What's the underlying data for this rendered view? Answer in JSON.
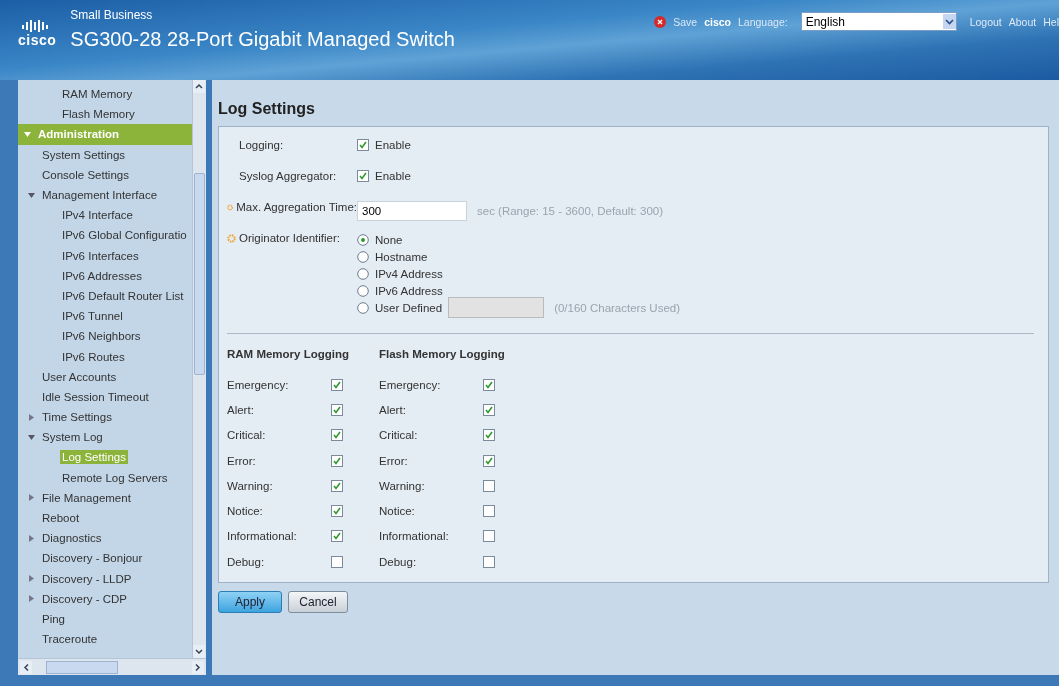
{
  "header": {
    "logo_text": "cisco",
    "brand_line": "Small Business",
    "title": "SG300-28 28-Port Gigabit Managed Switch",
    "save": "Save",
    "user": "cisco",
    "language_label": "Language:",
    "language_value": "English",
    "links": [
      "Logout",
      "About",
      "Hel"
    ]
  },
  "sidebar": {
    "partial_group": {
      "children": [
        {
          "label": "RAM Memory",
          "selected": false
        },
        {
          "label": "Flash Memory",
          "selected": false
        }
      ]
    },
    "items": [
      {
        "label": "Administration",
        "kind": "section",
        "expanded": true,
        "children": [
          {
            "label": "System Settings",
            "selected": false
          },
          {
            "label": "Console Settings",
            "selected": false
          },
          {
            "label": "Management Interface",
            "selected": false,
            "expanded": true,
            "children": [
              {
                "label": "IPv4 Interface",
                "selected": false
              },
              {
                "label": "IPv6 Global Configuratio",
                "selected": false
              },
              {
                "label": "IPv6 Interfaces",
                "selected": false
              },
              {
                "label": "IPv6 Addresses",
                "selected": false
              },
              {
                "label": "IPv6 Default Router List",
                "selected": false
              },
              {
                "label": "IPv6 Tunnel",
                "selected": false
              },
              {
                "label": "IPv6 Neighbors",
                "selected": false
              },
              {
                "label": "IPv6 Routes",
                "selected": false
              }
            ]
          },
          {
            "label": "User Accounts",
            "selected": false
          },
          {
            "label": "Idle Session Timeout",
            "selected": false
          },
          {
            "label": "Time Settings",
            "selected": false,
            "expanded": false
          },
          {
            "label": "System Log",
            "selected": false,
            "expanded": true,
            "children": [
              {
                "label": "Log Settings",
                "selected": true
              },
              {
                "label": "Remote Log Servers",
                "selected": false
              }
            ]
          },
          {
            "label": "File Management",
            "selected": false,
            "expanded": false
          },
          {
            "label": "Reboot",
            "selected": false
          },
          {
            "label": "Diagnostics",
            "selected": false,
            "expanded": false
          },
          {
            "label": "Discovery - Bonjour",
            "selected": false
          },
          {
            "label": "Discovery - LLDP",
            "selected": false,
            "expanded": false
          },
          {
            "label": "Discovery - CDP",
            "selected": false,
            "expanded": false
          },
          {
            "label": "Ping",
            "selected": false
          },
          {
            "label": "Traceroute",
            "selected": false
          }
        ]
      }
    ]
  },
  "page_title": "Log Settings",
  "settings": [
    {
      "kind": "checkbox",
      "label": "Logging:",
      "required": false,
      "option": "Enable",
      "checked": true
    },
    {
      "kind": "checkbox",
      "label": "Syslog Aggregator:",
      "required": false,
      "option": "Enable",
      "checked": true
    },
    {
      "kind": "text",
      "label": "Max. Aggregation Time:",
      "required": true,
      "value": "300",
      "hint": "sec (Range: 15 - 3600, Default: 300)"
    },
    {
      "kind": "radio",
      "label": "Originator Identifier:",
      "required": true,
      "options": [
        {
          "label": "None",
          "selected": true
        },
        {
          "label": "Hostname",
          "selected": false
        },
        {
          "label": "IPv4 Address",
          "selected": false
        },
        {
          "label": "IPv6 Address",
          "selected": false
        },
        {
          "label": "User Defined",
          "selected": false,
          "field_disabled": true,
          "hint": "(0/160 Characters Used)"
        }
      ]
    }
  ],
  "memory_logging": [
    {
      "title": "RAM Memory Logging",
      "levels": [
        {
          "label": "Emergency:",
          "checked": true
        },
        {
          "label": "Alert:",
          "checked": true
        },
        {
          "label": "Critical:",
          "checked": true
        },
        {
          "label": "Error:",
          "checked": true
        },
        {
          "label": "Warning:",
          "checked": true
        },
        {
          "label": "Notice:",
          "checked": true
        },
        {
          "label": "Informational:",
          "checked": true
        },
        {
          "label": "Debug:",
          "checked": false
        }
      ]
    },
    {
      "title": "Flash Memory Logging",
      "levels": [
        {
          "label": "Emergency:",
          "checked": true
        },
        {
          "label": "Alert:",
          "checked": true
        },
        {
          "label": "Critical:",
          "checked": true
        },
        {
          "label": "Error:",
          "checked": true
        },
        {
          "label": "Warning:",
          "checked": false
        },
        {
          "label": "Notice:",
          "checked": false
        },
        {
          "label": "Informational:",
          "checked": false
        },
        {
          "label": "Debug:",
          "checked": false
        }
      ]
    }
  ],
  "buttons": [
    {
      "label": "Apply",
      "primary": true
    },
    {
      "label": "Cancel",
      "primary": false
    }
  ]
}
